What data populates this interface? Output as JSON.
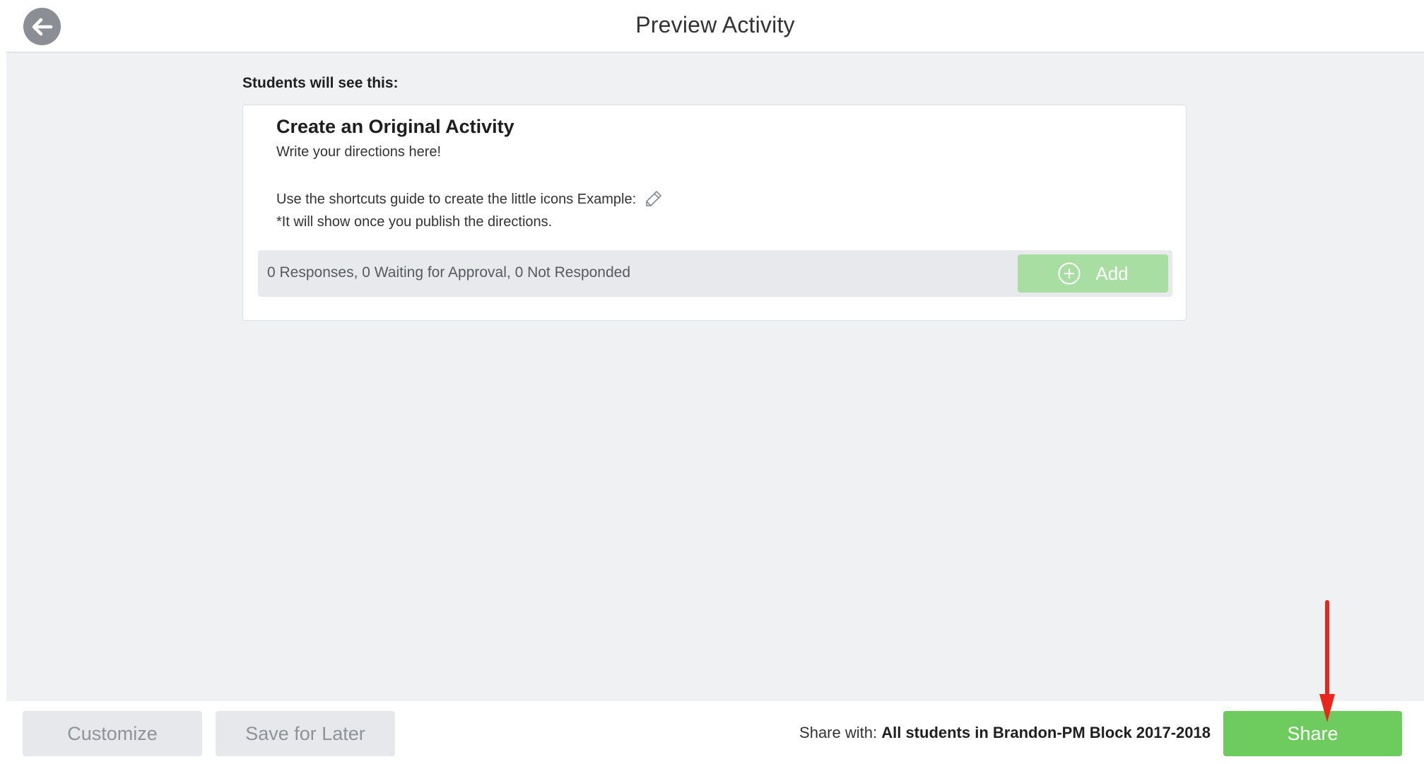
{
  "header": {
    "title": "Preview Activity",
    "back_icon": "arrow-left-icon"
  },
  "main": {
    "intro_label": "Students will see this:",
    "card": {
      "title": "Create an Original Activity",
      "line1": "Write your directions here!",
      "line2": "Use the shortcuts guide to create the little icons Example:",
      "line2_icon": "pencil-icon",
      "line3": "*It will show once you publish the directions.",
      "responses_summary": "0 Responses, 0 Waiting for Approval, 0 Not Responded",
      "add_label": "Add",
      "add_icon": "plus-circle-icon"
    }
  },
  "footer": {
    "customize_label": "Customize",
    "save_later_label": "Save for Later",
    "share_with_prefix": "Share with:",
    "share_with_target": "All students in Brandon-PM Block 2017-2018",
    "share_label": "Share"
  },
  "colors": {
    "accent_green": "#6dcc5d",
    "disabled_green": "#a9dea3",
    "annotation_red": "#e8261c",
    "background_gray": "#f0f1f3"
  }
}
